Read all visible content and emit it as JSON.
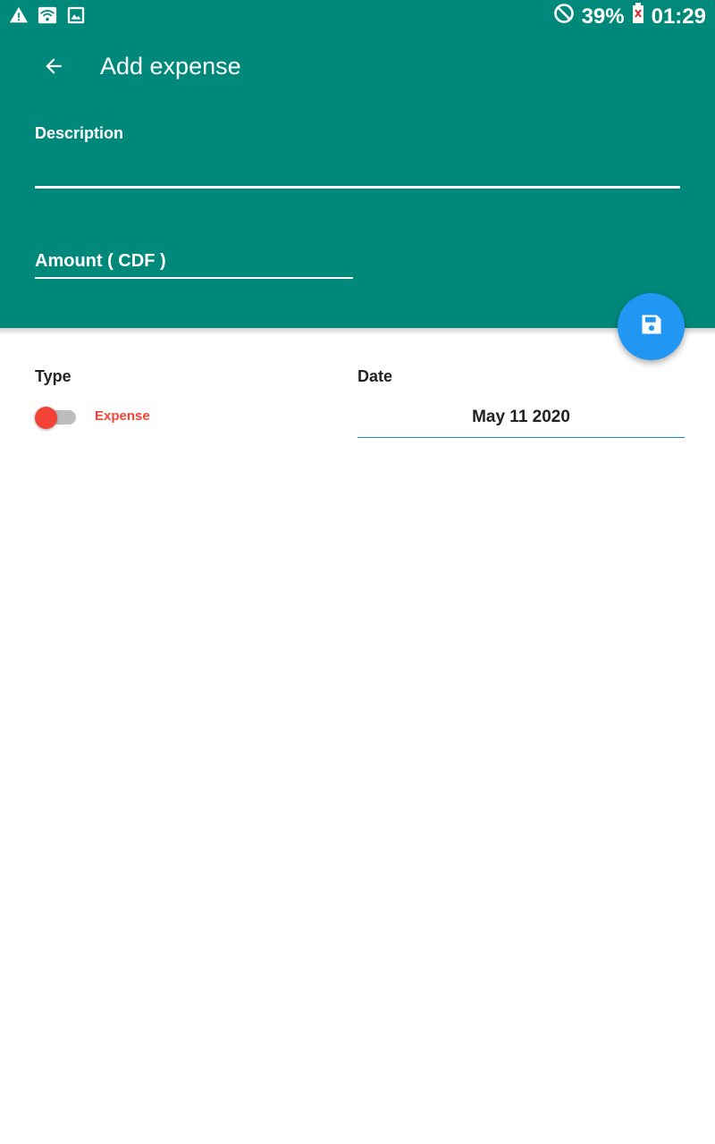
{
  "status_bar": {
    "battery": "39%",
    "time": "01:29",
    "left_icons": [
      "alert-icon",
      "wifi-icon",
      "image-icon"
    ],
    "right_icons": [
      "do-not-disturb-icon",
      "battery-icon"
    ]
  },
  "toolbar": {
    "title": "Add expense",
    "back_icon": "arrow-back-icon"
  },
  "form": {
    "description_label": "Description",
    "description_value": "",
    "amount_label": "Amount ( CDF )",
    "amount_value": "",
    "type_label": "Type",
    "type_value": "Expense",
    "date_label": "Date",
    "date_value": "May 11 2020"
  },
  "fab": {
    "icon": "save-icon"
  },
  "colors": {
    "primary": "#00897b",
    "accent": "#2196f3",
    "expense": "#f44336"
  }
}
